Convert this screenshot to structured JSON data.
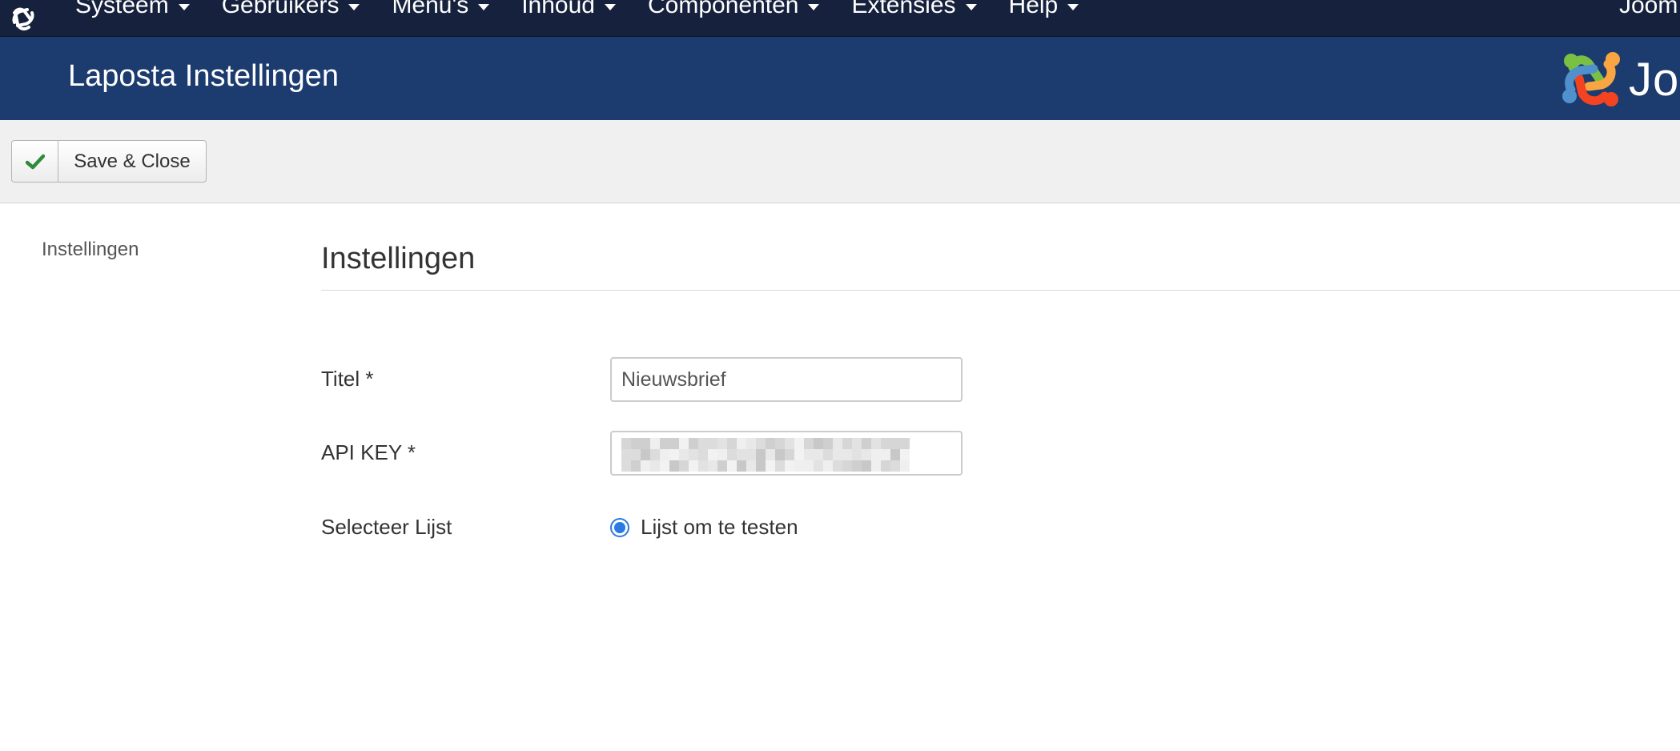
{
  "navbar": {
    "logo_icon": "joomla-icon",
    "items": [
      {
        "label": "Systeem"
      },
      {
        "label": "Gebruikers"
      },
      {
        "label": "Menu's"
      },
      {
        "label": "Inhoud"
      },
      {
        "label": "Componenten"
      },
      {
        "label": "Extensies"
      },
      {
        "label": "Help"
      }
    ],
    "right_text": "Joom"
  },
  "header": {
    "title": "Laposta Instellingen",
    "brand_text": "Jo",
    "colors": {
      "navbar": "#16213d",
      "header": "#1c3b6e"
    }
  },
  "toolbar": {
    "save_close_label": "Save & Close",
    "save_icon": "check-icon",
    "check_color": "#2f8a3a"
  },
  "sidebar": {
    "items": [
      {
        "label": "Instellingen"
      }
    ]
  },
  "main": {
    "section_title": "Instellingen",
    "fields": {
      "title": {
        "label": "Titel *",
        "value": "Nieuwsbrief"
      },
      "api_key": {
        "label": "API KEY *",
        "value": ""
      },
      "list": {
        "label": "Selecteer Lijst",
        "option": "Lijst om te testen",
        "selected": true
      }
    }
  }
}
